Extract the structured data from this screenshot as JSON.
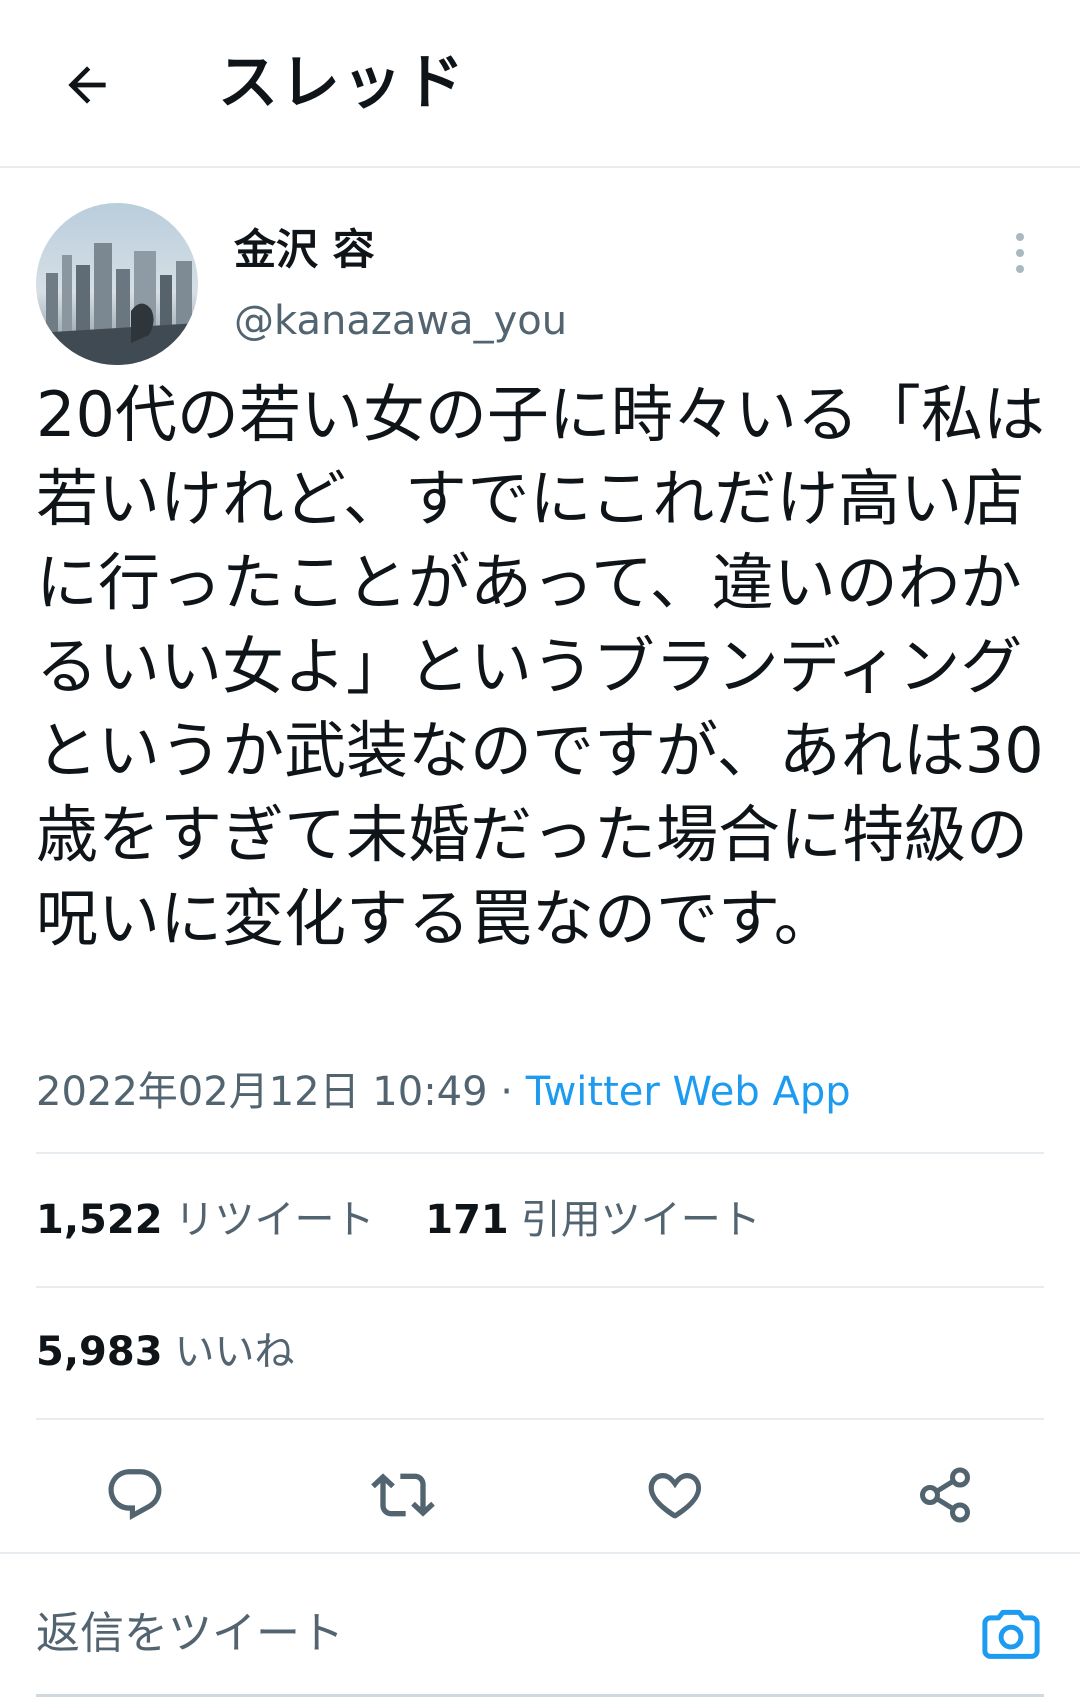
{
  "header": {
    "back_icon": "arrow-left-icon",
    "title": "スレッド"
  },
  "tweet": {
    "author": {
      "name": "金沢 容",
      "handle": "@kanazawa_you"
    },
    "more_icon": "more-vertical-icon",
    "text": "20代の若い女の子に時々いる「私は若いけれど、すでにこれだけ高い店に行ったことがあって、違いのわかるいい女よ」というブランディングというか武装なのですが、あれは30歳をすぎて未婚だった場合に特級の呪いに変化する罠なのです。",
    "timestamp": "2022年02月12日 10:49",
    "separator": " · ",
    "source": "Twitter Web App"
  },
  "stats": {
    "retweets": {
      "count": "1,522",
      "label": "リツイート"
    },
    "quotes": {
      "count": "171",
      "label": "引用ツイート"
    },
    "likes": {
      "count": "5,983",
      "label": "いいね"
    }
  },
  "actions": {
    "reply_icon": "reply-icon",
    "retweet_icon": "retweet-icon",
    "like_icon": "heart-icon",
    "share_icon": "share-icon"
  },
  "reply_bar": {
    "placeholder": "返信をツイート",
    "camera_icon": "camera-icon"
  },
  "colors": {
    "accent": "#1d9bf0",
    "text_primary": "#0f1419",
    "text_secondary": "#536471",
    "divider": "#e6ecf0"
  }
}
